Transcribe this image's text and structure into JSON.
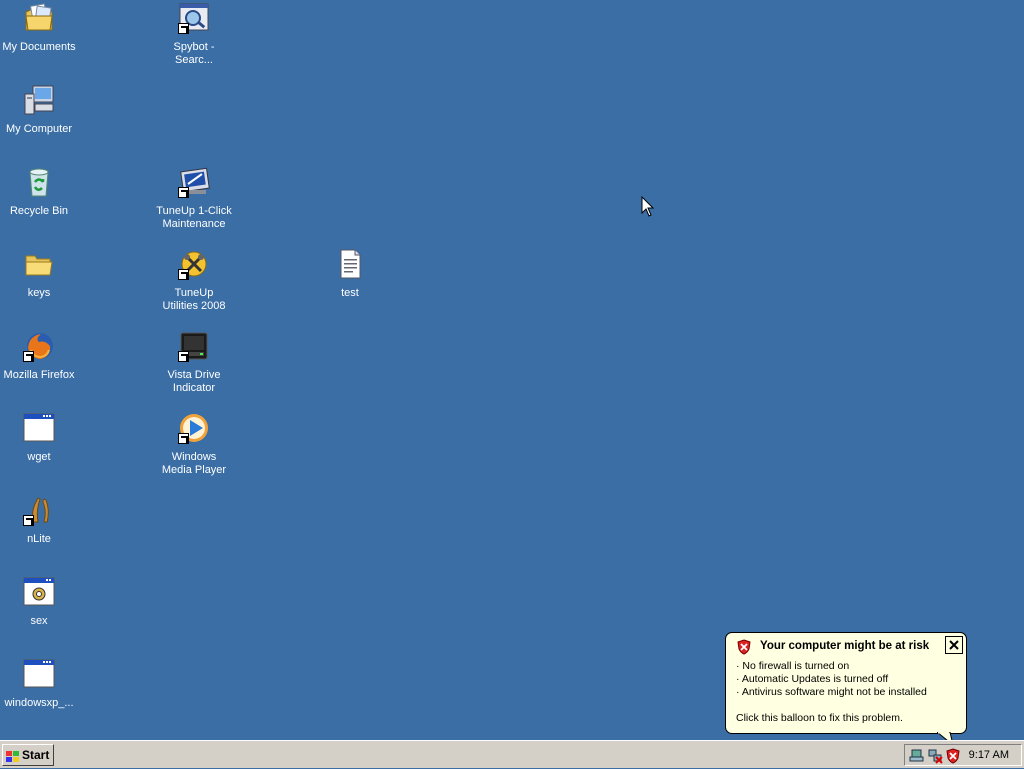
{
  "desktop": {
    "icons": [
      {
        "label": "My Documents",
        "icon": "my-documents-icon"
      },
      {
        "label": "My Computer",
        "icon": "my-computer-icon"
      },
      {
        "label": "Recycle Bin",
        "icon": "recycle-bin-icon"
      },
      {
        "label": "keys",
        "icon": "folder-icon"
      },
      {
        "label": "Mozilla Firefox",
        "icon": "firefox-icon"
      },
      {
        "label": "wget",
        "icon": "application-window-icon"
      },
      {
        "label": "nLite",
        "icon": "nlite-icon"
      },
      {
        "label": "sex",
        "icon": "application-gear-icon"
      },
      {
        "label": "windowsxp_...",
        "icon": "application-window-icon"
      },
      {
        "label": "Spybot - Searc...",
        "icon": "spybot-icon"
      },
      {
        "label": "TuneUp 1-Click Maintenance",
        "icon": "tuneup-maintenance-icon"
      },
      {
        "label": "TuneUp Utilities 2008",
        "icon": "tuneup-utilities-icon"
      },
      {
        "label": "Vista Drive Indicator",
        "icon": "drive-indicator-icon"
      },
      {
        "label": "Windows Media Player",
        "icon": "media-player-icon"
      },
      {
        "label": "test",
        "icon": "text-document-icon"
      }
    ]
  },
  "balloon": {
    "title": "Your computer might be at risk",
    "lines": [
      "· No firewall is turned on",
      "· Automatic Updates is turned off",
      "· Antivirus software might not be installed"
    ],
    "footer": "Click this balloon to fix this problem.",
    "icon": "security-shield-icon"
  },
  "taskbar": {
    "start_label": "Start",
    "clock": "9:17 AM",
    "tray_icons": [
      "network-icon",
      "network-disconnected-icon",
      "security-alert-icon"
    ]
  },
  "colors": {
    "desktop": "#3a6ea5",
    "taskbar": "#d4d0c8",
    "balloon": "#ffffe1"
  }
}
